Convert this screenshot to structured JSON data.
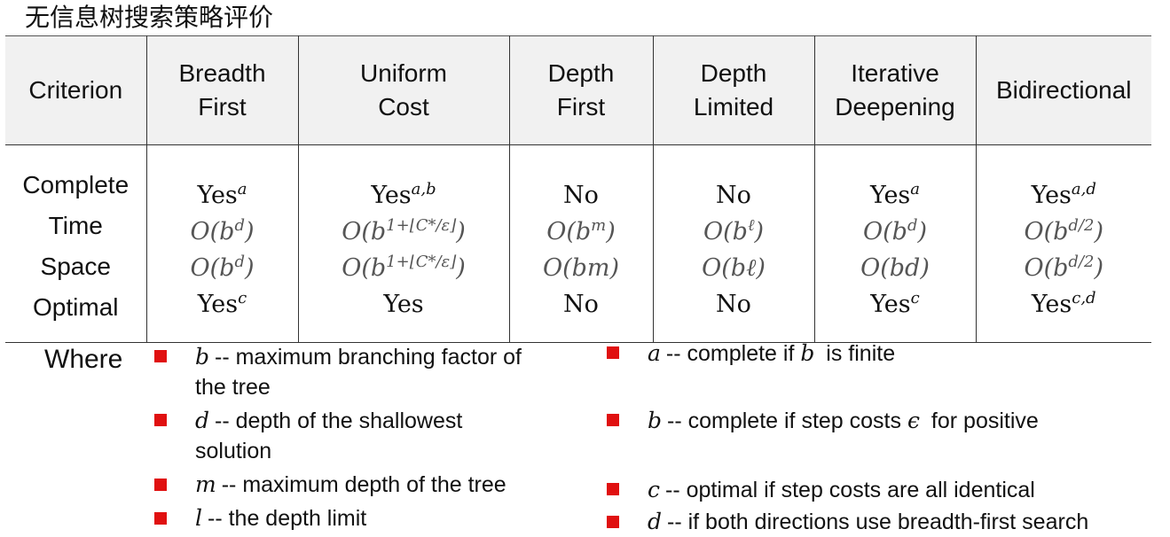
{
  "page_title": "无信息树搜索策略评价",
  "table": {
    "header_criterion": "Criterion",
    "columns": [
      {
        "name": "Breadth First",
        "line1": "Breadth",
        "line2": "First",
        "complete": "Yes",
        "complete_sup": "a",
        "time": "O(b",
        "time_sup": "d",
        "time_end": ")",
        "space": "O(b",
        "space_sup": "d",
        "space_end": ")",
        "optimal": "Yes",
        "optimal_sup": "c"
      },
      {
        "name": "Uniform Cost",
        "line1": "Uniform",
        "line2": "Cost",
        "complete": "Yes",
        "complete_sup": "a,b",
        "time": "O(b",
        "time_sup": "1+⌊C*/ε⌋",
        "time_end": ")",
        "space": "O(b",
        "space_sup": "1+⌊C*/ε⌋",
        "space_end": ")",
        "optimal": "Yes",
        "optimal_sup": ""
      },
      {
        "name": "Depth First",
        "line1": "Depth",
        "line2": "First",
        "complete": "No",
        "complete_sup": "",
        "time": "O(b",
        "time_sup": "m",
        "time_end": ")",
        "space": "O(bm)",
        "space_sup": "",
        "space_end": "",
        "optimal": "No",
        "optimal_sup": ""
      },
      {
        "name": "Depth Limited",
        "line1": "Depth",
        "line2": "Limited",
        "complete": "No",
        "complete_sup": "",
        "time": "O(b",
        "time_sup": "ℓ",
        "time_end": ")",
        "space": "O(bℓ)",
        "space_sup": "",
        "space_end": "",
        "optimal": "No",
        "optimal_sup": ""
      },
      {
        "name": "Iterative Deepening",
        "line1": "Iterative",
        "line2": "Deepening",
        "complete": "Yes",
        "complete_sup": "a",
        "time": "O(b",
        "time_sup": "d",
        "time_end": ")",
        "space": "O(bd)",
        "space_sup": "",
        "space_end": "",
        "optimal": "Yes",
        "optimal_sup": "c"
      },
      {
        "name": "Bidirectional",
        "line1": "Bidirectional",
        "line2": "",
        "complete": "Yes",
        "complete_sup": "a,d",
        "time": "O(b",
        "time_sup": "d/2",
        "time_end": ")",
        "space": "O(b",
        "space_sup": "d/2",
        "space_end": ")",
        "optimal": "Yes",
        "optimal_sup": "c,d"
      }
    ],
    "criteria": [
      "Complete",
      "Time",
      "Space",
      "Optimal"
    ]
  },
  "where_label": "Where",
  "left_notes": [
    {
      "var": "b",
      "text": "-- maximum branching factor of",
      "text2": "the tree"
    },
    {
      "var": "d",
      "text": "-- depth of the shallowest",
      "text2": "solution"
    },
    {
      "var": "m",
      "text": "-- maximum depth of the tree",
      "text2": ""
    },
    {
      "var": "l",
      "text": "-- the depth limit",
      "text2": ""
    }
  ],
  "right_notes": [
    {
      "var": "a",
      "pre": "-- complete if ",
      "mid_var": "b",
      "post": " is finite"
    },
    {
      "var": "b",
      "pre": "-- complete if step costs ",
      "mid_var": "ϵ",
      "post": " for positive"
    },
    {
      "var": "c",
      "pre": "-- optimal if step costs are all identical",
      "mid_var": "",
      "post": ""
    },
    {
      "var": "d",
      "pre": "-- if both directions use breadth-first search",
      "mid_var": "",
      "post": ""
    }
  ],
  "colors": {
    "bullet": "#e01010",
    "header_bg": "#f1f1f1",
    "math_gray": "#555555"
  }
}
